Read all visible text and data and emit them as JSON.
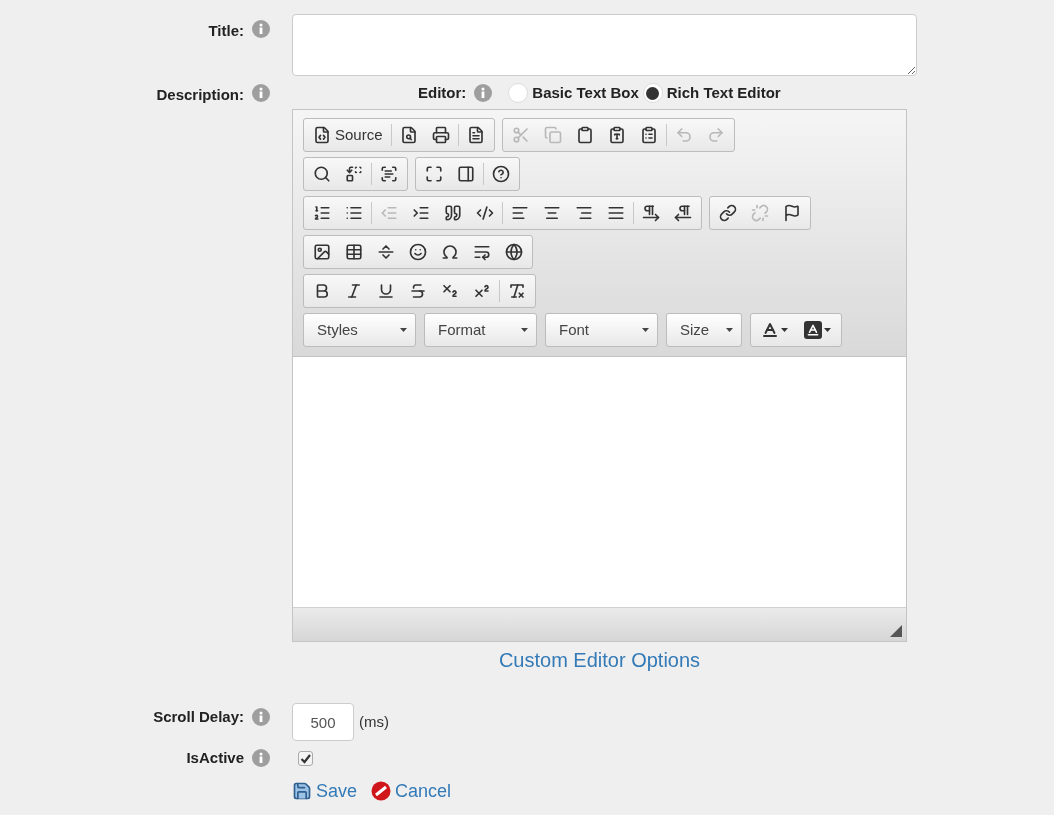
{
  "form": {
    "title": {
      "label": "Title:"
    },
    "description": {
      "label": "Description:"
    },
    "editor": {
      "label": "Editor:",
      "options": [
        {
          "label": "Basic Text Box",
          "selected": false
        },
        {
          "label": "Rich Text Editor",
          "selected": true
        }
      ]
    },
    "toolbar": {
      "rows": [
        [
          [
            [
              {
                "kind": "source",
                "label": "Source",
                "disabled": false
              }
            ],
            [
              {
                "kind": "preview",
                "disabled": false
              },
              {
                "kind": "print",
                "disabled": false
              }
            ],
            [
              {
                "kind": "templates",
                "disabled": false
              }
            ]
          ],
          [
            [
              {
                "kind": "cut",
                "disabled": true
              },
              {
                "kind": "copy",
                "disabled": true
              },
              {
                "kind": "paste",
                "disabled": false
              },
              {
                "kind": "pastetext",
                "disabled": false
              },
              {
                "kind": "pasteword",
                "disabled": false
              }
            ],
            [
              {
                "kind": "undo",
                "disabled": true
              },
              {
                "kind": "redo",
                "disabled": true
              }
            ]
          ]
        ],
        [
          [
            [
              {
                "kind": "find",
                "disabled": false
              },
              {
                "kind": "replace",
                "disabled": false
              }
            ],
            [
              {
                "kind": "selectall",
                "disabled": false
              }
            ]
          ],
          [
            [
              {
                "kind": "maximize",
                "disabled": false
              },
              {
                "kind": "showblocks",
                "disabled": false
              }
            ],
            [
              {
                "kind": "help",
                "disabled": false
              }
            ]
          ]
        ],
        [
          [
            [
              {
                "kind": "numberedlist",
                "disabled": false
              },
              {
                "kind": "bulletedlist",
                "disabled": false
              }
            ],
            [
              {
                "kind": "outdent",
                "disabled": true
              },
              {
                "kind": "indent",
                "disabled": false
              },
              {
                "kind": "blockquote",
                "disabled": false
              },
              {
                "kind": "creatediv",
                "disabled": false
              }
            ],
            [
              {
                "kind": "alignleft",
                "disabled": false
              },
              {
                "kind": "aligncenter",
                "disabled": false
              },
              {
                "kind": "alignright",
                "disabled": false
              },
              {
                "kind": "alignjustify",
                "disabled": false
              }
            ],
            [
              {
                "kind": "ltr",
                "disabled": false
              },
              {
                "kind": "rtl",
                "disabled": false
              }
            ]
          ],
          [
            [
              {
                "kind": "link",
                "disabled": false
              },
              {
                "kind": "unlink",
                "disabled": true
              },
              {
                "kind": "anchor",
                "disabled": false
              }
            ]
          ]
        ],
        [
          [
            [
              {
                "kind": "image",
                "disabled": false
              },
              {
                "kind": "table",
                "disabled": false
              },
              {
                "kind": "hline",
                "disabled": false
              },
              {
                "kind": "smiley",
                "disabled": false
              },
              {
                "kind": "specialchar",
                "disabled": false
              },
              {
                "kind": "pagebreak",
                "disabled": false
              },
              {
                "kind": "iframe",
                "disabled": false
              }
            ]
          ]
        ],
        [
          [
            [
              {
                "kind": "bold",
                "disabled": false
              },
              {
                "kind": "italic",
                "disabled": false
              },
              {
                "kind": "underline",
                "disabled": false
              },
              {
                "kind": "strike",
                "disabled": false
              },
              {
                "kind": "subscript",
                "disabled": false
              },
              {
                "kind": "superscript",
                "disabled": false
              }
            ],
            [
              {
                "kind": "removeformat",
                "disabled": false
              }
            ]
          ]
        ]
      ],
      "combos": [
        {
          "label": "Styles"
        },
        {
          "label": "Format"
        },
        {
          "label": "Font"
        },
        {
          "label": "Size"
        }
      ],
      "colors": [
        {
          "kind": "textcolor"
        },
        {
          "kind": "bgcolor"
        }
      ]
    },
    "custom_options_link": "Custom Editor Options",
    "scroll_delay": {
      "label": "Scroll Delay:",
      "value": "500",
      "unit": "(ms)"
    },
    "is_active": {
      "label": "IsActive",
      "checked": true
    },
    "actions": [
      {
        "kind": "save",
        "label": "Save"
      },
      {
        "kind": "cancel",
        "label": "Cancel"
      }
    ]
  }
}
